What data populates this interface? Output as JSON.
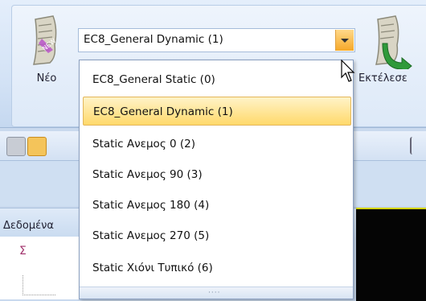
{
  "ribbon": {
    "new_label": "Νέο",
    "run_label": "Εκτέλεσε",
    "combo_value": "EC8_General Dynamic (1)"
  },
  "panel": {
    "title": "Δεδομένα"
  },
  "dropdown": {
    "selected_index": 1,
    "options": [
      "EC8_General Static (0)",
      "EC8_General Dynamic (1)",
      "Static Ανεμος 0 (2)",
      "Static Ανεμος 90 (3)",
      "Static Ανεμος 180 (4)",
      "Static Ανεμος 270 (5)",
      "Static Χιόνι Τυπικό (6)"
    ],
    "grip": "····"
  },
  "colors": {
    "highlight": "#ffd96b",
    "combo_button": "#f6a828",
    "ribbon": "#d4e3f6"
  }
}
